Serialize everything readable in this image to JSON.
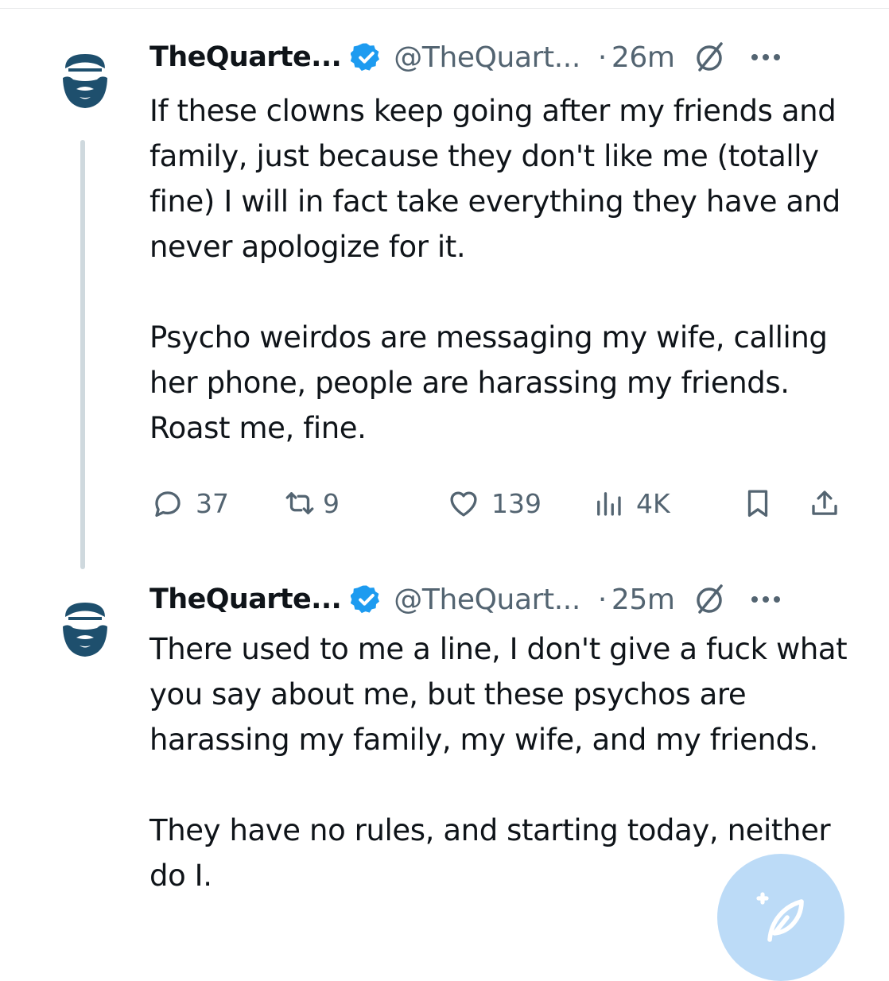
{
  "tweets": [
    {
      "author_name": "TheQuarte...",
      "handle": "@TheQuart...",
      "separator": "·",
      "time": "26m",
      "paragraphs": [
        "If these clowns keep going after my friends and family, just because they don't like me (totally fine) I will in fact take everything they have and never apologize for it.",
        "Psycho weirdos are messaging my wife, calling her phone, people are harassing my friends.  Roast me, fine."
      ],
      "metrics": {
        "replies": "37",
        "reposts": "9",
        "likes": "139",
        "views": "4K"
      }
    },
    {
      "author_name": "TheQuarte...",
      "handle": "@TheQuart...",
      "separator": "·",
      "time": "25m",
      "paragraphs": [
        "There used to me a line, I don't give a fuck what you say about me, but these psychos are harassing my family, my wife, and my friends.",
        "They have no rules, and starting today, neither do I."
      ]
    }
  ],
  "colors": {
    "verified": "#1d9bf0",
    "avatar": "#1e4f6d",
    "muted": "#536471",
    "thread_line": "#cfd9de",
    "fab": "#bcdbf7"
  },
  "icons": {
    "avatar": "bearded-man-logo",
    "verified": "verified-badge-icon",
    "grok": "grok-icon",
    "more": "more-icon",
    "reply": "reply-icon",
    "repost": "repost-icon",
    "like": "like-icon",
    "views": "views-icon",
    "bookmark": "bookmark-icon",
    "share": "share-icon",
    "compose": "compose-post-icon"
  }
}
